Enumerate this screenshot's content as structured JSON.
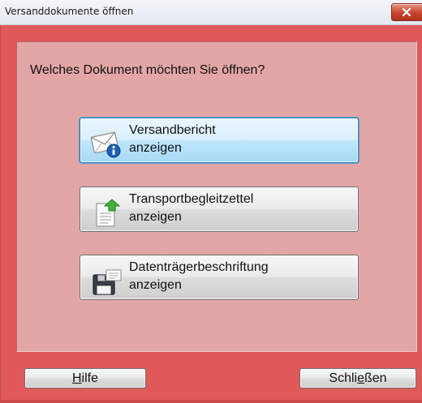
{
  "window": {
    "title": "Versanddokumente öffnen"
  },
  "dialog": {
    "question": "Welches Dokument möchten Sie öffnen?",
    "buttons": [
      {
        "line1": "Versandbericht",
        "line2": "anzeigen",
        "icon": "envelope-info-icon"
      },
      {
        "line1": "Transportbegleitzettel",
        "line2": "anzeigen",
        "icon": "document-arrow-icon"
      },
      {
        "line1": "Datenträgerbeschriftung",
        "line2": "anzeigen",
        "icon": "floppy-label-icon"
      }
    ]
  },
  "footer": {
    "help": {
      "underlined": "H",
      "rest": "ilfe"
    },
    "close": {
      "before": "Schli",
      "underlined": "e",
      "after": "ßen"
    }
  },
  "colors": {
    "frame": "#e05a5a",
    "panel": "#e3a6a6",
    "active_button": "#bee6fd"
  }
}
